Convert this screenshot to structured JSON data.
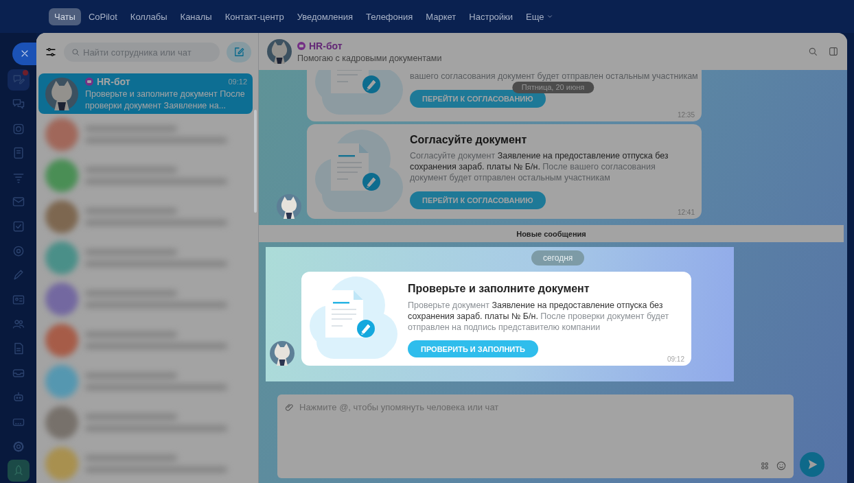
{
  "top_nav": {
    "items": [
      {
        "label": "Чаты",
        "selected": true,
        "kind": "link"
      },
      {
        "label": "CoPilot",
        "selected": false,
        "kind": "link"
      },
      {
        "label": "Коллабы",
        "selected": false,
        "kind": "link"
      },
      {
        "label": "Каналы",
        "selected": false,
        "kind": "link"
      },
      {
        "label": "Контакт-центр",
        "selected": false,
        "kind": "link"
      },
      {
        "label": "Уведомления",
        "selected": false,
        "kind": "link"
      },
      {
        "label": "Телефония",
        "selected": false,
        "kind": "link"
      },
      {
        "label": "Маркет",
        "selected": false,
        "kind": "link"
      },
      {
        "label": "Настройки",
        "selected": false,
        "kind": "link"
      },
      {
        "label": "Еще",
        "selected": false,
        "kind": "dropdown"
      }
    ]
  },
  "sidebar": {
    "items": [
      {
        "kind": "chat-edit",
        "selected": true,
        "badge": true
      },
      {
        "kind": "chats",
        "selected": false,
        "badge": false
      },
      {
        "kind": "lens",
        "selected": false,
        "badge": false
      },
      {
        "kind": "document",
        "selected": false,
        "badge": false
      },
      {
        "kind": "funnel",
        "selected": false,
        "badge": false
      },
      {
        "kind": "mail",
        "selected": false,
        "badge": false
      },
      {
        "kind": "task",
        "selected": false,
        "badge": false
      },
      {
        "kind": "target",
        "selected": false,
        "badge": false
      },
      {
        "kind": "pen",
        "selected": false,
        "badge": false
      },
      {
        "kind": "id-card",
        "selected": false,
        "badge": false
      },
      {
        "kind": "people",
        "selected": false,
        "badge": false
      },
      {
        "kind": "file",
        "selected": false,
        "badge": false
      },
      {
        "kind": "inbox",
        "selected": false,
        "badge": false
      },
      {
        "kind": "robot",
        "selected": false,
        "badge": false
      },
      {
        "kind": "calendar",
        "selected": false,
        "badge": false
      },
      {
        "kind": "settings",
        "selected": false,
        "badge": false
      },
      {
        "kind": "rocket",
        "selected": false,
        "badge": false
      }
    ]
  },
  "chat_list": {
    "search": {
      "placeholder": "Найти сотрудника или чат"
    },
    "chats": [
      {
        "kind": "bot",
        "name": "HR-бот",
        "time": "09:12",
        "preview": "Проверьте и заполните документ После проверки документ Заявление на...",
        "selected": true
      },
      {
        "kind": "blurred",
        "color": "#a0675a",
        "selected": false
      },
      {
        "kind": "blurred",
        "color": "#4a8e55",
        "selected": false
      },
      {
        "kind": "blurred",
        "color": "#7d6750",
        "selected": false
      },
      {
        "kind": "blurred",
        "color": "#4a8f88",
        "selected": false
      },
      {
        "kind": "blurred",
        "color": "#7368a0",
        "selected": false
      },
      {
        "kind": "blurred",
        "color": "#a65c48",
        "selected": false
      },
      {
        "kind": "blurred",
        "color": "#5597b0",
        "selected": false
      },
      {
        "kind": "blurred",
        "color": "#77716b",
        "selected": false
      },
      {
        "kind": "blurred",
        "color": "#a8904f",
        "selected": false
      }
    ]
  },
  "chat": {
    "header": {
      "name": "HR-бот",
      "status": "Помогаю с кадровыми документами"
    },
    "date_label": "Пятница, 20 июня",
    "messages": [
      {
        "kind": "clipped",
        "text": "вашего согласования документ будет отправлен остальным участникам",
        "button": "ПЕРЕЙТИ К СОГЛАСОВАНИЮ",
        "time": "12:35",
        "show_avatar": false
      },
      {
        "kind": "full",
        "title": "Согласуйте документ",
        "text": "Согласуйте документ **Заявление на предоставление отпуска без сохранения зараб. платы № Б/н.** После вашего согласования документ будет отправлен остальным участникам",
        "button": "ПЕРЕЙТИ К СОГЛАСОВАНИЮ",
        "time": "12:41",
        "show_avatar": true
      }
    ],
    "new_messages_label": "Новые сообщения",
    "highlighted": {
      "date_label": "сегодня",
      "title": "Проверьте и заполните документ",
      "text": "Проверьте документ **Заявление на предоставление отпуска без сохранения зараб. платы № Б/н.** После проверки документ будет отправлен на подпись представителю компании",
      "button": "ПРОВЕРИТЬ И ЗАПОЛНИТЬ",
      "time": "09:12"
    },
    "composer": {
      "placeholder": "Нажмите @, чтобы упомянуть человека или чат"
    }
  }
}
